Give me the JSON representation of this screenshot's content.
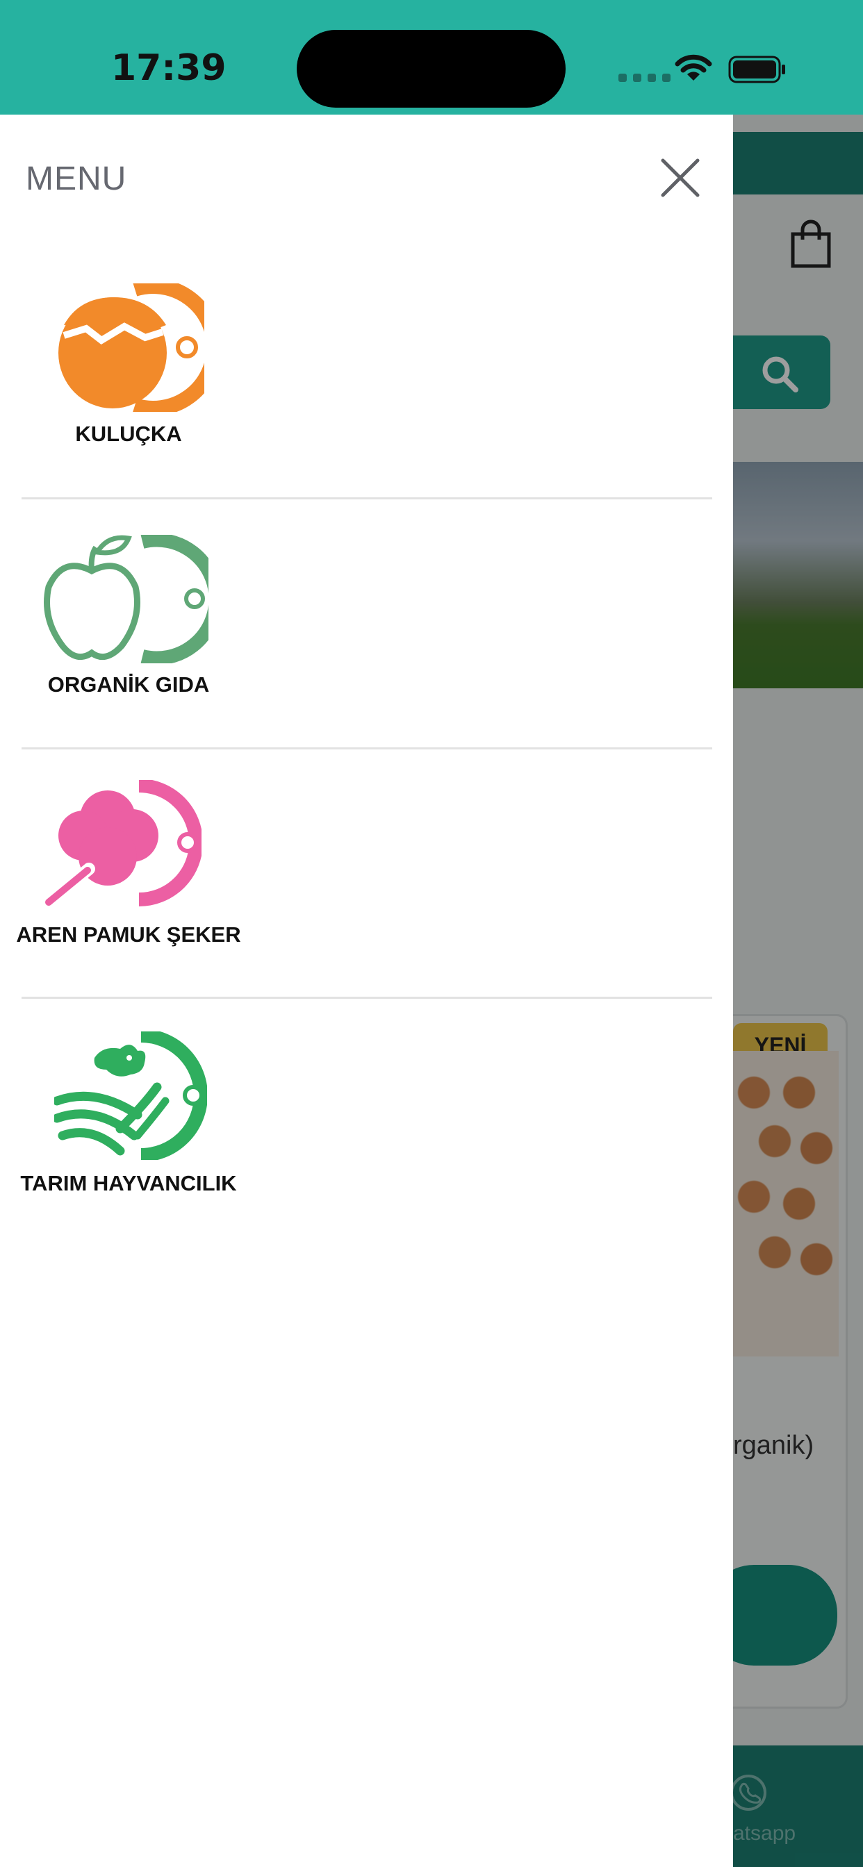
{
  "status_bar": {
    "time": "17:39"
  },
  "drawer": {
    "title": "MENU",
    "items": [
      {
        "label": "KULUÇKA",
        "icon": "egg-hatching-icon",
        "color": "#f28a2a"
      },
      {
        "label": "ORGANİK GIDA",
        "icon": "apple-icon",
        "color": "#5fa776"
      },
      {
        "label": "AREN PAMUK ŞEKER",
        "icon": "cotton-candy-icon",
        "color": "#ec5fa3"
      },
      {
        "label": "TARIM HAYVANCILIK",
        "icon": "farm-cow-icon",
        "color": "#2fae5e"
      }
    ]
  },
  "background_app": {
    "badge": "YENİ",
    "product_name_fragment": "rganik)",
    "bottom_nav_label_fragment": "atsapp"
  },
  "colors": {
    "brand_teal": "#26b2a0",
    "dark_teal": "#1c7f72"
  }
}
